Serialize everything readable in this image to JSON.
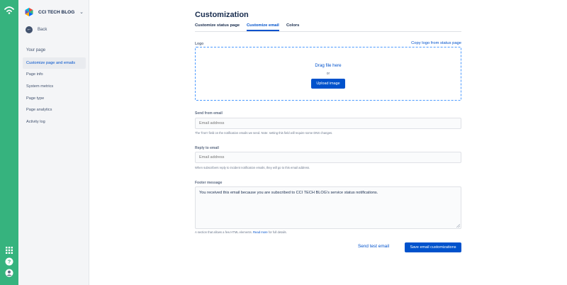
{
  "sidebar": {
    "brand_name": "CCI TECH BLOG",
    "back_label": "Back",
    "section_heading": "Your page",
    "items": [
      {
        "label": "Customize page and emails"
      },
      {
        "label": "Page info"
      },
      {
        "label": "System metrics"
      },
      {
        "label": "Page type"
      },
      {
        "label": "Page analytics"
      },
      {
        "label": "Activity log"
      }
    ]
  },
  "rail": {
    "icons": [
      "statuspage-logo-icon",
      "app-switcher-icon",
      "help-icon",
      "profile-icon"
    ]
  },
  "page": {
    "title": "Customization",
    "tabs": [
      {
        "label": "Customize status page"
      },
      {
        "label": "Customize email"
      },
      {
        "label": "Colors"
      }
    ]
  },
  "logo": {
    "label": "Logo",
    "copy_link": "Copy logo from status page",
    "drag_text": "Drag file here",
    "or_text": "or",
    "upload_label": "Upload image"
  },
  "send_from": {
    "label": "Send from email",
    "placeholder": "Email address",
    "help": "The 'from' field on the notification emails we send. Note: setting this field will require some DNS changes."
  },
  "reply_to": {
    "label": "Reply to email",
    "placeholder": "Email address",
    "help": "When subscribers reply to incident notification emails, they will go to this email address."
  },
  "footer": {
    "label": "Footer message",
    "value": "You received this email because you are subscribed to CCI TECH BLOG's service status notifications.",
    "help_prefix": "A section that allows a few HTML elements.",
    "help_link": "Read more",
    "help_suffix": "for full details."
  },
  "actions": {
    "send_test": "Send test email",
    "save": "Save email customizations"
  },
  "colors": {
    "accent": "#0052cc",
    "rail": "#36b37e",
    "sidebar_bg": "#f4f5f7"
  }
}
